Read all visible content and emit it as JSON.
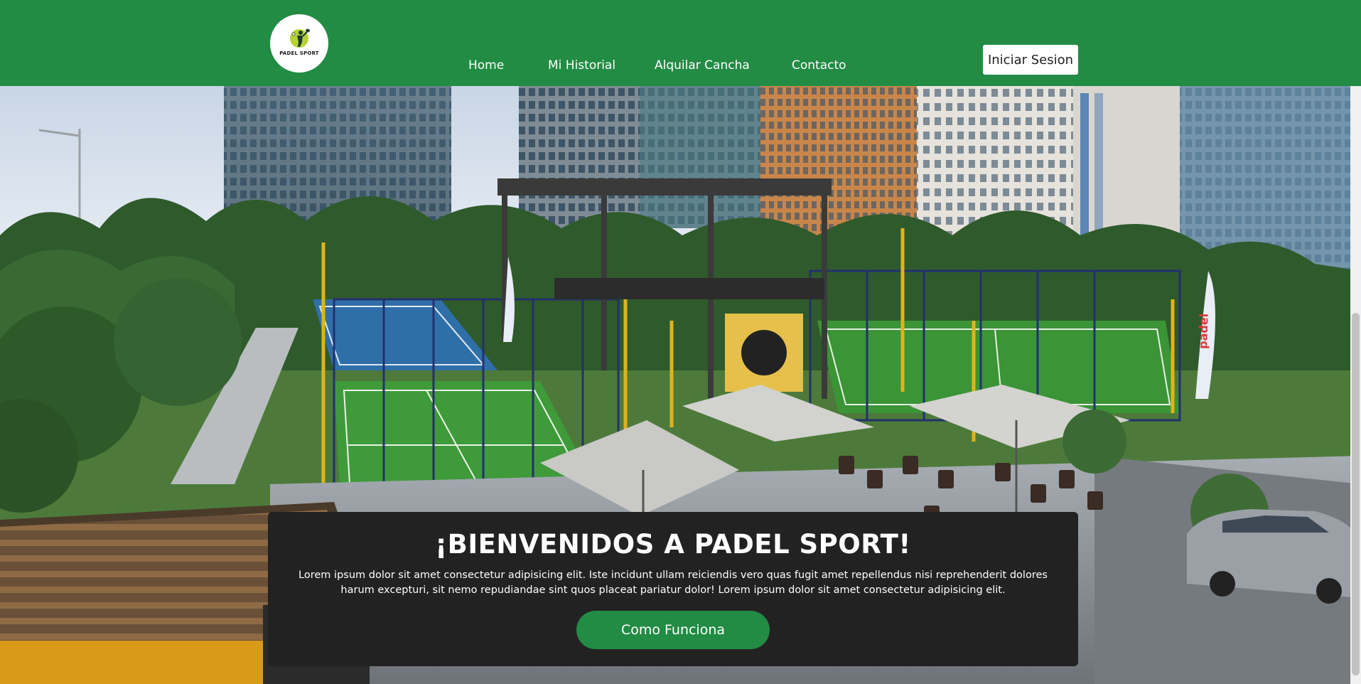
{
  "header": {
    "logo_text": "PADEL SPORT",
    "nav": [
      {
        "label": "Home"
      },
      {
        "label": "Mi Historial"
      },
      {
        "label": "Alquilar Cancha"
      },
      {
        "label": "Contacto"
      }
    ],
    "login_label": "Iniciar Sesion"
  },
  "hero": {
    "flag_text": "padel"
  },
  "welcome": {
    "title": "¡BIENVENIDOS A PADEL SPORT!",
    "text": "Lorem ipsum dolor sit amet consectetur adipisicing elit. Iste incidunt ullam reiciendis vero quas fugit amet repellendus nisi reprehenderit dolores harum excepturi, sit nemo repudiandae sint quos placeat pariatur dolor! Lorem ipsum dolor sit amet consectetur adipisicing elit.",
    "cta_label": "Como Funciona"
  },
  "colors": {
    "brand_green": "#228b44",
    "card_bg": "#222222",
    "white": "#ffffff"
  },
  "icons": {
    "logo": "padel-player-icon"
  }
}
